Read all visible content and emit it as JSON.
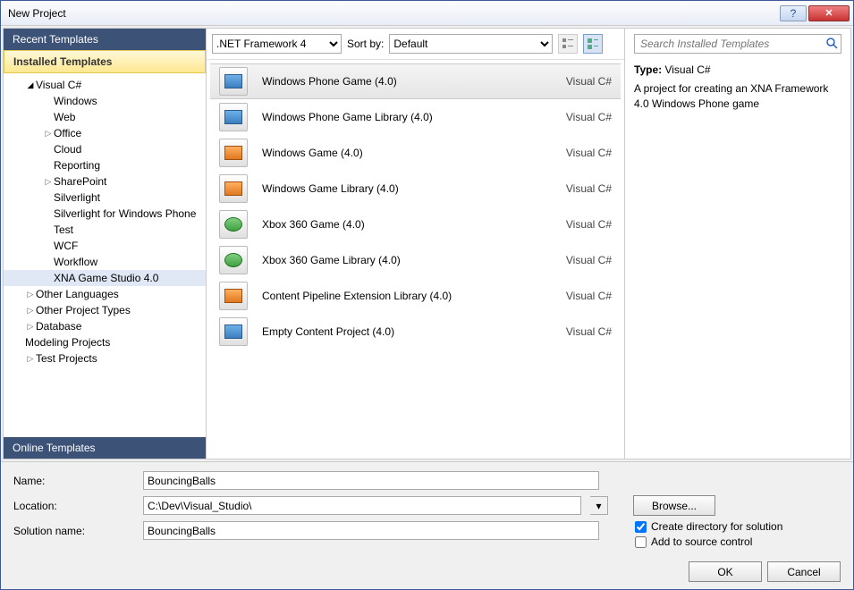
{
  "window": {
    "title": "New Project"
  },
  "left": {
    "recent": "Recent Templates",
    "installed": "Installed Templates",
    "online": "Online Templates",
    "tree": [
      {
        "label": "Visual C#",
        "arrow": "open",
        "indent": 1
      },
      {
        "label": "Windows",
        "indent": 2
      },
      {
        "label": "Web",
        "indent": 2
      },
      {
        "label": "Office",
        "arrow": "closed",
        "indent": 2
      },
      {
        "label": "Cloud",
        "indent": 2
      },
      {
        "label": "Reporting",
        "indent": 2
      },
      {
        "label": "SharePoint",
        "arrow": "closed",
        "indent": 2
      },
      {
        "label": "Silverlight",
        "indent": 2
      },
      {
        "label": "Silverlight for Windows Phone",
        "indent": 2
      },
      {
        "label": "Test",
        "indent": 2
      },
      {
        "label": "WCF",
        "indent": 2
      },
      {
        "label": "Workflow",
        "indent": 2
      },
      {
        "label": "XNA Game Studio 4.0",
        "indent": 2,
        "selected": true
      },
      {
        "label": "Other Languages",
        "arrow": "closed",
        "indent": 1
      },
      {
        "label": "Other Project Types",
        "arrow": "closed",
        "indent": 1
      },
      {
        "label": "Database",
        "arrow": "closed",
        "indent": 1
      },
      {
        "label": "Modeling Projects",
        "indent": 1
      },
      {
        "label": "Test Projects",
        "arrow": "closed",
        "indent": 1
      }
    ]
  },
  "filter": {
    "framework": ".NET Framework 4",
    "sort_label": "Sort by:",
    "sort_value": "Default"
  },
  "templates": [
    {
      "name": "Windows Phone Game (4.0)",
      "lang": "Visual C#",
      "selected": true,
      "iconcls": ""
    },
    {
      "name": "Windows Phone Game Library (4.0)",
      "lang": "Visual C#",
      "iconcls": ""
    },
    {
      "name": "Windows Game (4.0)",
      "lang": "Visual C#",
      "iconcls": "orange"
    },
    {
      "name": "Windows Game Library (4.0)",
      "lang": "Visual C#",
      "iconcls": "orange"
    },
    {
      "name": "Xbox 360 Game (4.0)",
      "lang": "Visual C#",
      "iconcls": "green"
    },
    {
      "name": "Xbox 360 Game Library (4.0)",
      "lang": "Visual C#",
      "iconcls": "green"
    },
    {
      "name": "Content Pipeline Extension Library (4.0)",
      "lang": "Visual C#",
      "iconcls": "orange"
    },
    {
      "name": "Empty Content Project (4.0)",
      "lang": "Visual C#",
      "iconcls": ""
    }
  ],
  "right": {
    "search_placeholder": "Search Installed Templates",
    "type_label": "Type:",
    "type_value": "Visual C#",
    "description": "A project for creating an XNA Framework 4.0 Windows Phone game"
  },
  "form": {
    "name_label": "Name:",
    "name_value": "BouncingBalls",
    "location_label": "Location:",
    "location_value": "C:\\Dev\\Visual_Studio\\",
    "solution_label": "Solution name:",
    "solution_value": "BouncingBalls",
    "browse": "Browse...",
    "create_dir": "Create directory for solution",
    "source_control": "Add to source control"
  },
  "buttons": {
    "ok": "OK",
    "cancel": "Cancel"
  }
}
